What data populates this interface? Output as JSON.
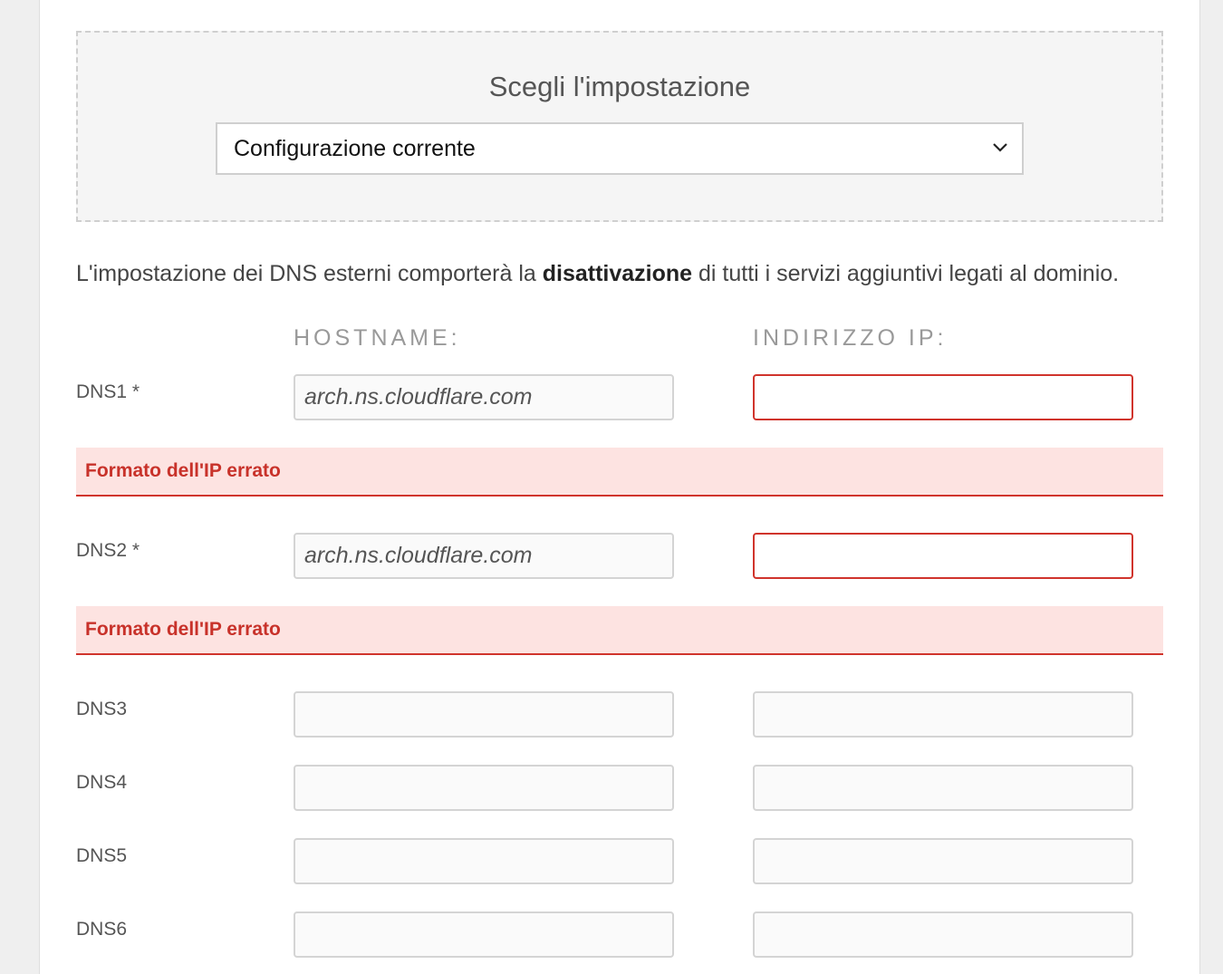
{
  "chooser": {
    "title": "Scegli l'impostazione",
    "selected": "Configurazione corrente"
  },
  "notice": {
    "before": "L'impostazione dei DNS esterni comporterà la ",
    "bold": "disattivazione",
    "after": " di tutti i servizi aggiuntivi legati al dominio."
  },
  "columns": {
    "hostname": "HOSTNAME:",
    "ip": "INDIRIZZO IP:"
  },
  "rows": [
    {
      "label": "DNS1 *",
      "hostname_placeholder": "arch.ns.cloudflare.com",
      "ip_value": "",
      "error": "Formato dell'IP errato"
    },
    {
      "label": "DNS2 *",
      "hostname_placeholder": "arch.ns.cloudflare.com",
      "ip_value": "",
      "error": "Formato dell'IP errato"
    },
    {
      "label": "DNS3",
      "hostname_placeholder": "",
      "ip_value": ""
    },
    {
      "label": "DNS4",
      "hostname_placeholder": "",
      "ip_value": ""
    },
    {
      "label": "DNS5",
      "hostname_placeholder": "",
      "ip_value": ""
    },
    {
      "label": "DNS6",
      "hostname_placeholder": "",
      "ip_value": ""
    }
  ],
  "colors": {
    "error": "#d0342c",
    "error_bg": "#fde3e1",
    "panel_bg": "#f5f5f5"
  }
}
